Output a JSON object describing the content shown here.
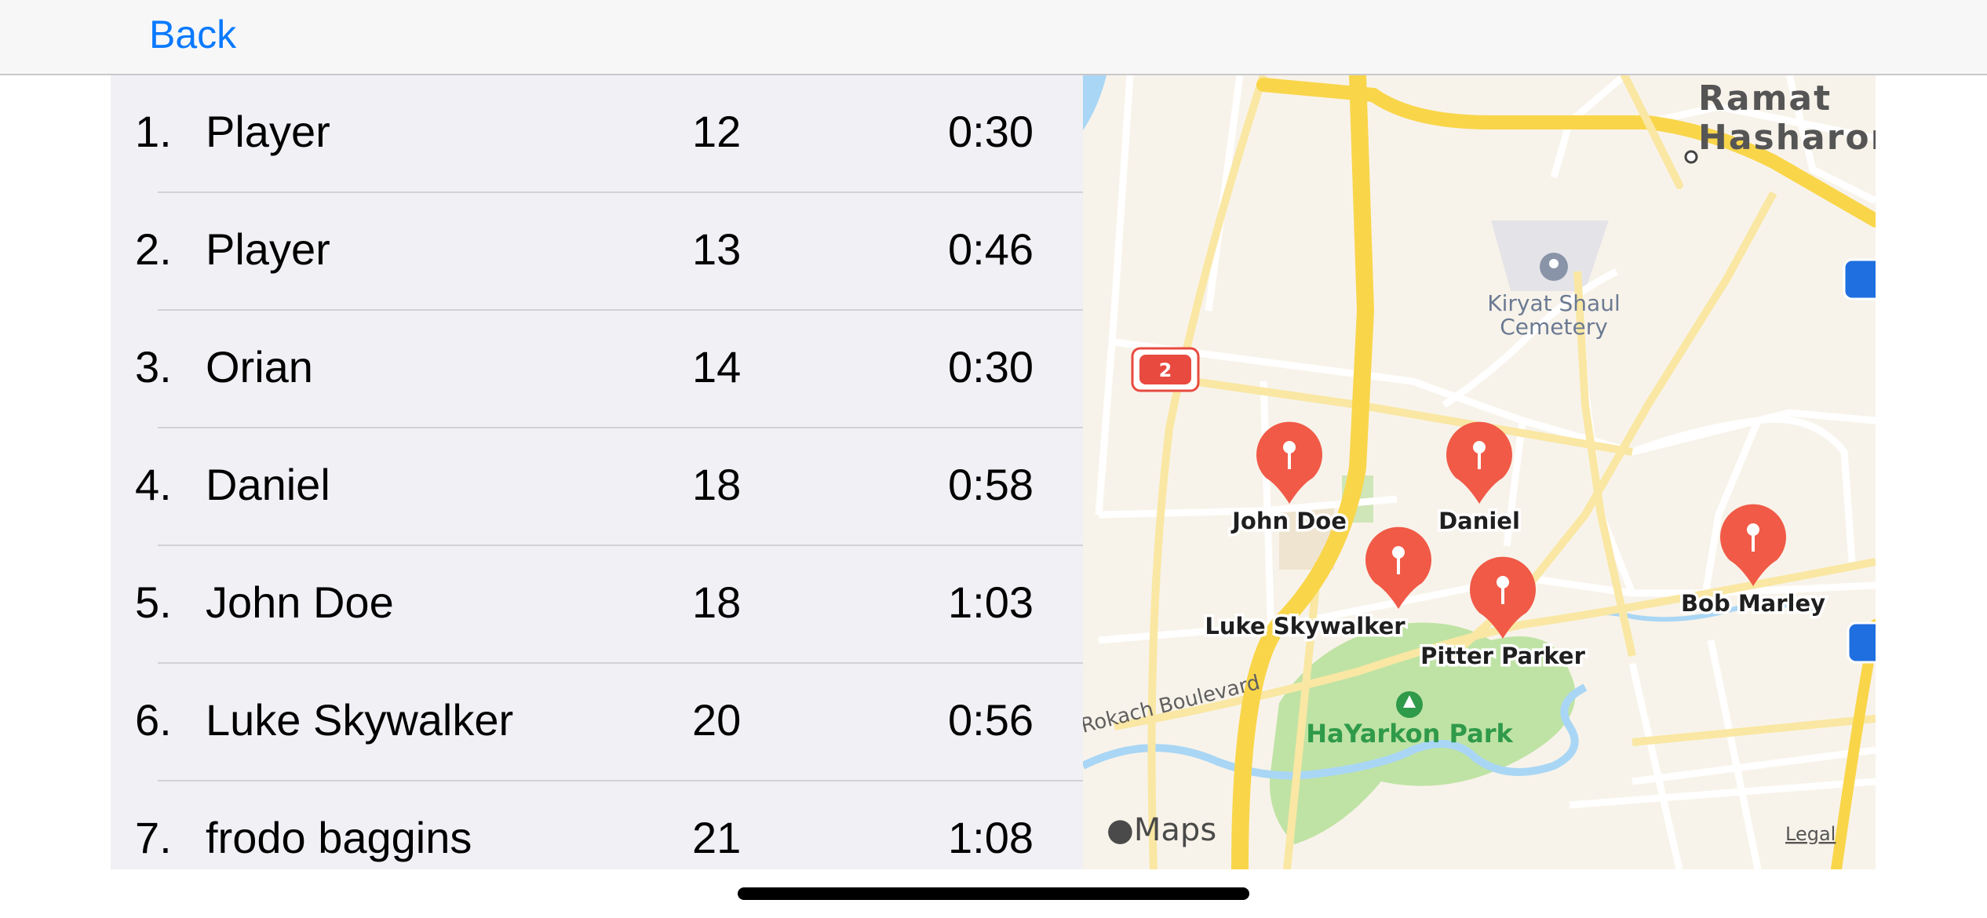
{
  "nav": {
    "back_label": "Back"
  },
  "leaderboard": [
    {
      "rank": "1.",
      "name": "Player",
      "steps": "12",
      "time": "0:30"
    },
    {
      "rank": "2.",
      "name": "Player",
      "steps": "13",
      "time": "0:46"
    },
    {
      "rank": "3.",
      "name": "Orian",
      "steps": "14",
      "time": "0:30"
    },
    {
      "rank": "4.",
      "name": "Daniel",
      "steps": "18",
      "time": "0:58"
    },
    {
      "rank": "5.",
      "name": "John Doe",
      "steps": "18",
      "time": "1:03"
    },
    {
      "rank": "6.",
      "name": "Luke Skywalker",
      "steps": "20",
      "time": "0:56"
    },
    {
      "rank": "7.",
      "name": "frodo baggins",
      "steps": "21",
      "time": "1:08"
    }
  ],
  "map": {
    "city_line1": "Ramat",
    "city_line2": "Hasharon",
    "cemetery_line1": "Kiryat Shaul",
    "cemetery_line2": "Cemetery",
    "park": "HaYarkon Park",
    "road": "Rokach Boulevard",
    "route_shield": "2",
    "attribution": "Maps",
    "legal": "Legal",
    "pins": [
      {
        "label": "John Doe"
      },
      {
        "label": "Daniel"
      },
      {
        "label": "Luke Skywalker"
      },
      {
        "label": "Pitter Parker"
      },
      {
        "label": "Bob Marley"
      }
    ],
    "colors": {
      "pin": "#f05a47",
      "highway": "#f9d54a",
      "park": "#bfe3a5",
      "water": "#a9d6f5"
    }
  }
}
